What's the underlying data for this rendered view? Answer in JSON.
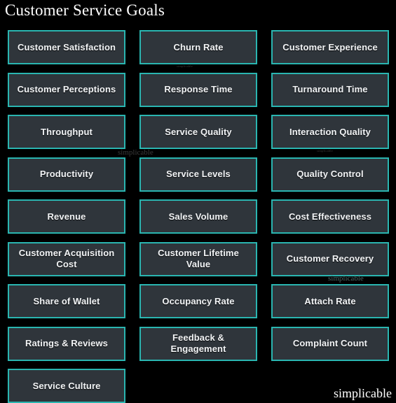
{
  "page": {
    "title": "Customer Service Goals",
    "background_color": "#000000",
    "card_fill_color": "#2f353b",
    "card_border_color": "#2ab5b0",
    "card_text_color": "#f2f4f6",
    "title_color": "#ffffff"
  },
  "grid": {
    "columns": 3,
    "cards": [
      {
        "label": "Customer Satisfaction"
      },
      {
        "label": "Churn Rate"
      },
      {
        "label": "Customer Experience"
      },
      {
        "label": "Customer Perceptions"
      },
      {
        "label": "Response Time"
      },
      {
        "label": "Turnaround Time"
      },
      {
        "label": "Throughput"
      },
      {
        "label": "Service Quality"
      },
      {
        "label": "Interaction Quality"
      },
      {
        "label": "Productivity"
      },
      {
        "label": "Service Levels"
      },
      {
        "label": "Quality Control"
      },
      {
        "label": "Revenue"
      },
      {
        "label": "Sales Volume"
      },
      {
        "label": "Cost Effectiveness"
      },
      {
        "label": "Customer Acquisition Cost"
      },
      {
        "label": "Customer Lifetime Value"
      },
      {
        "label": "Customer Recovery"
      },
      {
        "label": "Share of Wallet"
      },
      {
        "label": "Occupancy Rate"
      },
      {
        "label": "Attach Rate"
      },
      {
        "label": "Ratings & Reviews"
      },
      {
        "label": "Feedback & Engagement"
      },
      {
        "label": "Complaint Count"
      },
      {
        "label": "Service Culture"
      }
    ]
  },
  "watermarks": {
    "tiny_top": "simplicable",
    "mid_left": "simplicable",
    "tiny_mid": "simplicable",
    "teal": "simplicable",
    "main": "simplicable"
  }
}
